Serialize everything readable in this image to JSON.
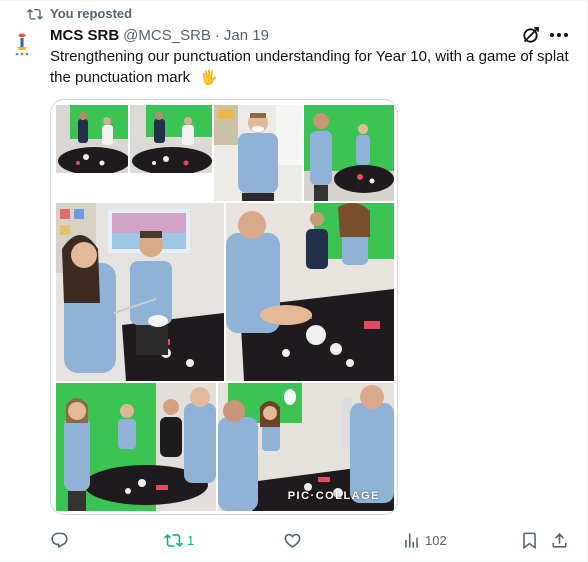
{
  "repost_banner": {
    "text": "You reposted",
    "icon": "repost-icon"
  },
  "author": {
    "display_name": "MCS SRB",
    "handle": "@MCS_SRB",
    "separator": "·",
    "date": "Jan 19",
    "avatar_icon": "school-logo-icon"
  },
  "tweet": {
    "text": "Strengthening our punctuation understanding for Year 10, with a game of splat the punctuation mark",
    "emoji": "🖐"
  },
  "header_icons": {
    "grok": "grok-icon",
    "more": "more-icon"
  },
  "media": {
    "watermark": "PIC·COLLAGE",
    "photo_count": 9
  },
  "actions": {
    "reply": {
      "icon": "reply-icon",
      "count": ""
    },
    "repost": {
      "icon": "repost-icon",
      "count": "1",
      "active_color": "#00ba7c"
    },
    "like": {
      "icon": "heart-icon",
      "count": ""
    },
    "views": {
      "icon": "views-icon",
      "count": "102"
    },
    "bookmark": {
      "icon": "bookmark-icon"
    },
    "share": {
      "icon": "share-icon"
    }
  },
  "colors": {
    "text": "#0f1419",
    "muted": "#536471",
    "border": "#cfd9de",
    "green": "#00ba7c"
  }
}
